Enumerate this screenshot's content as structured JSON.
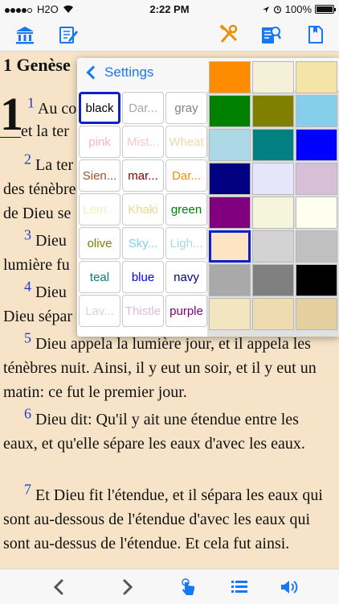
{
  "status": {
    "carrier": "H2O",
    "time": "2:22 PM",
    "battery": "100%"
  },
  "toolbar": {
    "icons": [
      "library-icon",
      "edit-icon",
      "tools-icon",
      "search-icon",
      "bookmark-icon"
    ]
  },
  "book": {
    "title": "1 Genèse",
    "chapter": "1",
    "verses": [
      {
        "num": "1",
        "text": "Au co"
      },
      {
        "cont": "et la ter"
      },
      {
        "num": "2",
        "text": "La ter"
      },
      {
        "cont": "des ténèbre"
      },
      {
        "cont": "de Dieu se"
      },
      {
        "num": "3",
        "text": "Dieu"
      },
      {
        "cont": "lumière fu"
      },
      {
        "num": "4",
        "text": "Dieu"
      },
      {
        "cont": "Dieu sépar"
      }
    ],
    "full_verses": [
      {
        "num": "5",
        "text": "Dieu appela la lumière jour, et il appela les ténèbres nuit. Ainsi, il y eut un soir, et il y eut un matin: ce fut le premier jour."
      },
      {
        "num": "6",
        "text": "Dieu dit: Qu'il y ait une étendue entre les eaux, et qu'elle sépare les eaux d'avec les eaux."
      },
      {
        "num": "7",
        "text": "Et Dieu fit l'étendue, et il sépara les eaux qui sont au-dessous de l'étendue d'avec les eaux qui sont au-dessus de l'étendue. Et cela fut ainsi."
      }
    ]
  },
  "settings": {
    "back_label": "Settings",
    "colors": [
      {
        "label": "black",
        "color": "#000000",
        "selected": true
      },
      {
        "label": "Dar...",
        "color": "#a9a9a9"
      },
      {
        "label": "gray",
        "color": "#808080"
      },
      {
        "label": "pink",
        "color": "#f4b8c4"
      },
      {
        "label": "Mist...",
        "color": "#f5c8cc"
      },
      {
        "label": "Wheat",
        "color": "#f0d8a8"
      },
      {
        "label": "Sien...",
        "color": "#a0522d"
      },
      {
        "label": "mar...",
        "color": "#800000"
      },
      {
        "label": "Dar...",
        "color": "#e8900c"
      },
      {
        "label": "Lem...",
        "color": "#f6ecc0"
      },
      {
        "label": "Khaki",
        "color": "#e8d890"
      },
      {
        "label": "green",
        "color": "#008000"
      },
      {
        "label": "olive",
        "color": "#808000"
      },
      {
        "label": "Sky...",
        "color": "#87ceeb"
      },
      {
        "label": "Ligh...",
        "color": "#add8e6"
      },
      {
        "label": "teal",
        "color": "#008080"
      },
      {
        "label": "blue",
        "color": "#0000ff"
      },
      {
        "label": "navy",
        "color": "#000080"
      },
      {
        "label": "Lav...",
        "color": "#d8d0e8"
      },
      {
        "label": "Thistle",
        "color": "#d8bfd8"
      },
      {
        "label": "purple",
        "color": "#800080"
      }
    ],
    "swatches": [
      "#ff8c00",
      "#f5f0d8",
      "#f5e4a8",
      "#008000",
      "#808000",
      "#87ceeb",
      "#add8e6",
      "#008080",
      "#0000ff",
      "#000080",
      "#e6e6fa",
      "#d8bfd8",
      "#800080",
      "#f5f5dc",
      "#fffff0",
      "#ffe4c4",
      "#d3d3d3",
      "#c0c0c0",
      "#a9a9a9",
      "#808080",
      "#000000",
      "#f2e6c0",
      "#eedcb0",
      "#e4cfa0"
    ]
  },
  "bottom": {
    "icons": [
      "back-arrow-icon",
      "forward-arrow-icon",
      "tap-hand-icon",
      "list-icon",
      "speaker-icon"
    ]
  }
}
